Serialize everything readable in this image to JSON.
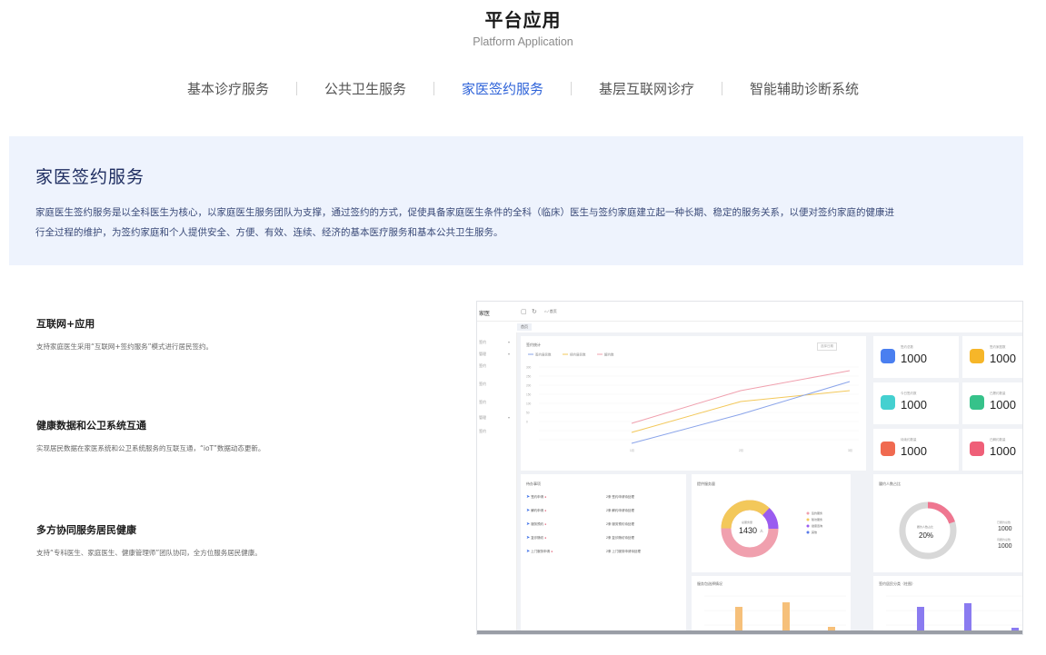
{
  "header": {
    "title": "平台应用",
    "subtitle": "Platform Application"
  },
  "tabs": [
    {
      "label": "基本诊疗服务",
      "active": false
    },
    {
      "label": "公共卫生服务",
      "active": false
    },
    {
      "label": "家医签约服务",
      "active": true
    },
    {
      "label": "基层互联网诊疗",
      "active": false
    },
    {
      "label": "智能辅助诊断系统",
      "active": false
    }
  ],
  "intro": {
    "title": "家医签约服务",
    "text_line1": "家庭医生签约服务是以全科医生为核心，以家庭医生服务团队为支撑，通过签约的方式，促使具备家庭医生条件的全科（临床）医生与签约家庭建立起一种长期、稳定的服务关系，以便对签约家庭的健康进",
    "text_line2": "行全过程的维护，为签约家庭和个人提供安全、方便、有效、连续、经济的基本医疗服务和基本公共卫生服务。"
  },
  "features": [
    {
      "title": "互联网+应用",
      "desc": "支持家庭医生采用“互联网+签约服务”模式进行居民签约。"
    },
    {
      "title": "健康数据和公卫系统互通",
      "desc": "实现居民数据在家医系统和公卫系统服务的互联互通，“ioT”数据动态更新。"
    },
    {
      "title": "多方协同服务居民健康",
      "desc": "支持“专科医生、家庭医生、健康管理师”团队协同，全方位服务居民健康。"
    }
  ],
  "dashboard": {
    "logo": "家医",
    "breadcrumb": "⌂ / 首页",
    "tag": "首页",
    "sidebar_items": [
      "签约",
      "管理",
      "签约",
      "签约",
      "签约",
      "管理",
      "签约"
    ],
    "chart_title": "签约统计",
    "chart_filter": "选择日期",
    "chart_legend": [
      "签约居民数",
      "续约居民数",
      "解约数"
    ],
    "chart_y_ticks": [
      "300",
      "250",
      "200",
      "150",
      "100",
      "50",
      "0",
      "",
      ""
    ],
    "chart_x_ticks": [
      "1月",
      "2月",
      "3月"
    ],
    "colors": {
      "pink": "#f0a0ae",
      "yellow": "#f3c85a",
      "blue": "#8aa4ea",
      "accent": "#2d62d8"
    },
    "stats": [
      {
        "label": "签约总数",
        "value": "1000",
        "color": "#4a7ff0"
      },
      {
        "label": "签约家庭数",
        "value": "1000",
        "color": "#f6b629"
      },
      {
        "label": "今日签约数",
        "value": "1000",
        "color": "#44d0d0"
      },
      {
        "label": "已履约数量",
        "value": "1000",
        "color": "#36c28a"
      },
      {
        "label": "待续约数量",
        "value": "1000",
        "color": "#f06a50"
      },
      {
        "label": "已解约数量",
        "value": "1000",
        "color": "#ef5f78"
      }
    ],
    "todo": {
      "title": "待办事项",
      "rows": [
        {
          "left": "签约申请",
          "right": "2条 签约申请待处理"
        },
        {
          "left": "解约申请",
          "right": "2条 解约申请待处理"
        },
        {
          "left": "服务预约",
          "right": "2条 服务预约待处理"
        },
        {
          "left": "复诊随访",
          "right": "2条 复诊随访待处理"
        },
        {
          "left": "上门服务申请",
          "right": "2条 上门服务申请待处理"
        }
      ]
    },
    "service": {
      "title": "提供服务量",
      "center_label": "总服务量",
      "center_value": "1430",
      "center_unit": "人",
      "legend": [
        "签约服务",
        "随访服务",
        "健康咨询",
        "其他"
      ]
    },
    "signing_ratio": {
      "title": "履约人数占比",
      "center_label": "履约人数占比",
      "center_value": "20%",
      "right_items": [
        {
          "label": "已履约总数",
          "value": "1000"
        },
        {
          "label": "待履约总数",
          "value": "1000"
        }
      ]
    },
    "package_title": "服务包选择情况",
    "trend_title": "签约居民分类（柱图）"
  }
}
